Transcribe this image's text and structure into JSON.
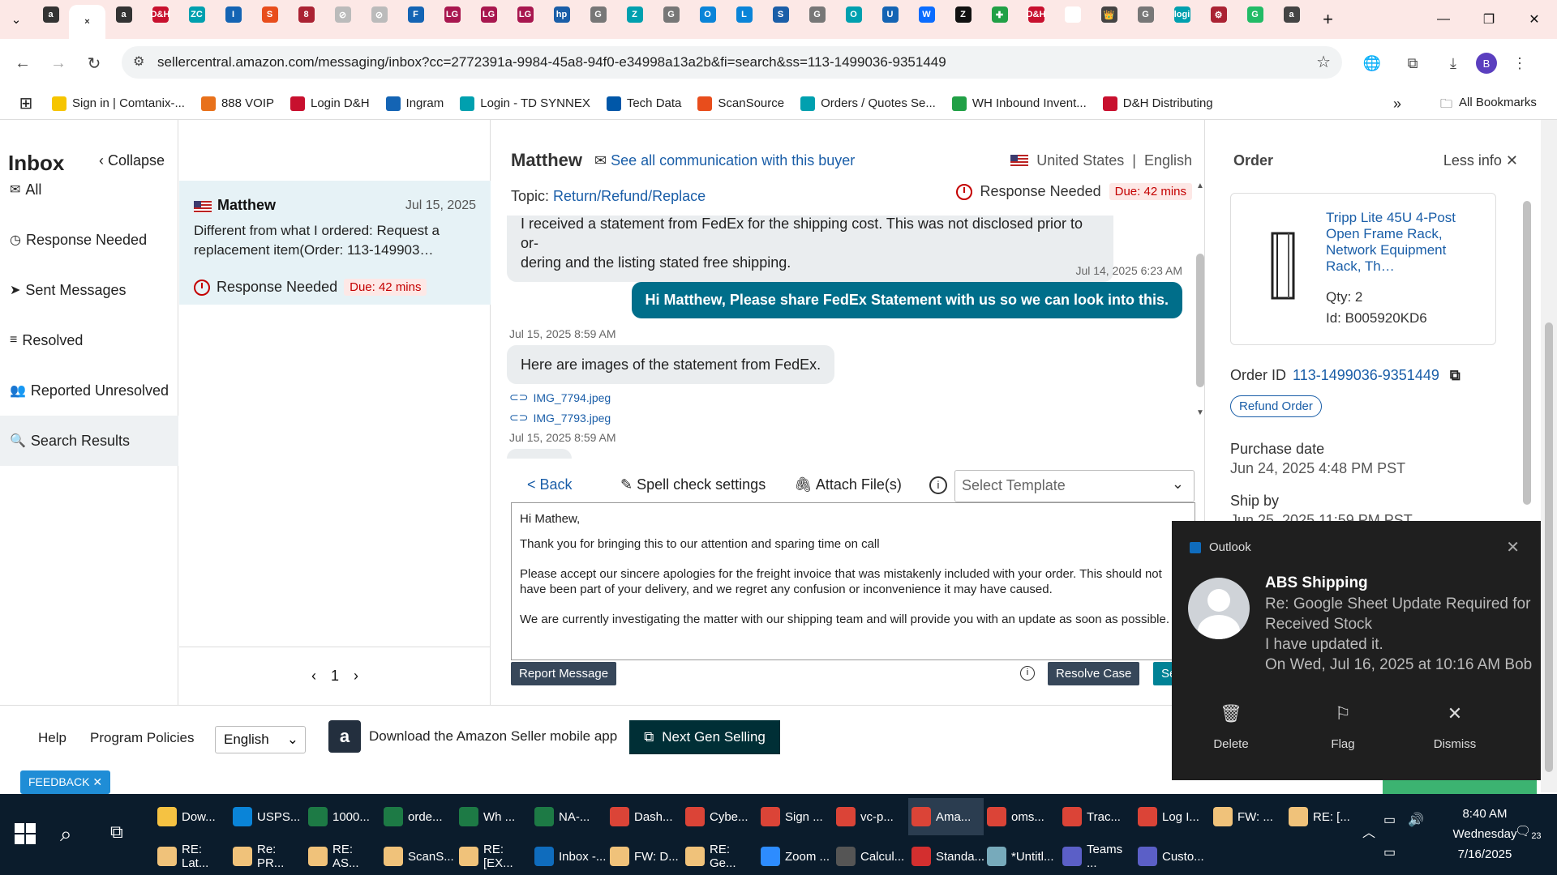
{
  "browser": {
    "tabs": [
      "a",
      "×",
      "a",
      "D&H",
      "ZC",
      "I",
      "S",
      "8",
      "⊘",
      "⊘",
      "F",
      "LG",
      "LG",
      "LG",
      "hp",
      "G",
      "Z",
      "G",
      "O",
      "L",
      "S",
      "G",
      "O",
      "U",
      "W",
      "Z",
      "✚",
      "D&H",
      "✉",
      "👑",
      "G",
      "logi",
      "⚙",
      "G",
      "a"
    ],
    "new_tab": "+",
    "url": "sellercentral.amazon.com/messaging/inbox?cc=2772391a-9984-45a8-94f0-e34998a13a2b&fi=search&ss=113-1499036-9351449",
    "profile": "B",
    "bookmarks": [
      {
        "label": "Sign in | Comtanix-...",
        "color": "#f6c500"
      },
      {
        "label": "888 VOIP",
        "color": "#e8711b"
      },
      {
        "label": "Login D&H",
        "color": "#c8102e"
      },
      {
        "label": "Ingram",
        "color": "#1464b4"
      },
      {
        "label": "Login - TD SYNNEX",
        "color": "#00a0af"
      },
      {
        "label": "Tech Data",
        "color": "#0057a8"
      },
      {
        "label": "ScanSource",
        "color": "#e84d1c"
      },
      {
        "label": "Orders / Quotes Se...",
        "color": "#00a0af"
      },
      {
        "label": "WH Inbound Invent...",
        "color": "#21a046"
      },
      {
        "label": "D&H Distributing",
        "color": "#c8102e"
      }
    ],
    "more_bookmarks": "»",
    "all_bookmarks": "All Bookmarks"
  },
  "sidebar": {
    "title": "Inbox",
    "collapse": "Collapse",
    "items": [
      {
        "label": "All",
        "icon": "✉"
      },
      {
        "label": "Response Needed",
        "icon": "◷"
      },
      {
        "label": "Sent Messages",
        "icon": "➤"
      },
      {
        "label": "Resolved",
        "icon": "≡"
      },
      {
        "label": "Reported Unresolved",
        "icon": "👥"
      },
      {
        "label": "Search Results",
        "icon": "🔍"
      }
    ]
  },
  "conversation": {
    "name": "Matthew",
    "date": "Jul 15, 2025",
    "preview": "Different from what I ordered: Request a replacement item(Order: 113-149903…",
    "status": "Response Needed",
    "due": "Due: 42 mins",
    "page": "1"
  },
  "chat": {
    "buyer": "Matthew",
    "see_all": "See all communication with this buyer",
    "country": "United States",
    "language": "English",
    "topic_label": "Topic:",
    "topic": "Return/Refund/Replace",
    "status": "Response Needed",
    "due": "Due: 42 mins",
    "msg1": "I received a statement from FedEx for the shipping cost. This was not disclosed prior to or-dering and the listing stated free shipping.",
    "msg1_line1": "I received a statement from FedEx for the shipping cost. This was not disclosed prior to or-",
    "msg1_line2": "dering and the listing stated free shipping.",
    "ts_out": "Jul 14, 2025 6:23 AM",
    "msg_out": "Hi Matthew, Please share FedEx Statement with us so we can look into this.",
    "ts_in": "Jul 15, 2025 8:59 AM",
    "msg2": "Here are images of the statement from FedEx.",
    "attachments": [
      "IMG_7794.jpeg",
      "IMG_7793.jpeg"
    ],
    "ts_in2": "Jul 15, 2025 8:59 AM",
    "back": "< Back",
    "spell": "Spell check settings",
    "attach": "Attach File(s)",
    "template_placeholder": "Select Template",
    "reply_lines": [
      "Hi Mathew,",
      "Thank you for bringing this to our attention and sparing time on call",
      "Please accept our sincere apologies for the freight invoice that was mistakenly included with your order. This should not have been part of your delivery, and we regret any confusion or inconvenience it may have caused.",
      "We are currently investigating the matter with our shipping team and will provide you with an update as soon as possible."
    ],
    "report": "Report Message",
    "resolve": "Resolve Case",
    "send": "Se"
  },
  "order": {
    "title": "Order",
    "less_info": "Less info",
    "product": "Tripp Lite 45U 4-Post Open Frame Rack, Network Equipment Rack, Th…",
    "qty": "Qty: 2",
    "id": "Id: B005920KD6",
    "order_id_label": "Order ID",
    "order_id": "113-1499036-9351449",
    "refund": "Refund Order",
    "purchase_label": "Purchase date",
    "purchase": "Jun 24, 2025 4:48 PM PST",
    "ship_label": "Ship by",
    "ship": "Jun 25, 2025 11:59 PM PST"
  },
  "footer": {
    "help": "Help",
    "policies": "Program Policies",
    "language": "English",
    "app": "Download the Amazon Seller mobile app",
    "ngs": "Next Gen Selling",
    "feedback": "FEEDBACK"
  },
  "toast": {
    "app": "Outlook",
    "sender": "ABS Shipping",
    "lines": [
      "Re: Google Sheet Update Required for",
      "Received Stock",
      "I have updated it.",
      "On Wed, Jul 16, 2025 at 10:16 AM Bob"
    ],
    "delete": "Delete",
    "flag": "Flag",
    "dismiss": "Dismiss"
  },
  "taskbar": {
    "row1": [
      {
        "label": "Dow...",
        "color": "#f5c242"
      },
      {
        "label": "USPS...",
        "color": "#0a84d8"
      },
      {
        "label": "1000...",
        "color": "#1d7a45"
      },
      {
        "label": "orde...",
        "color": "#1d7a45"
      },
      {
        "label": "Wh ...",
        "color": "#1d7a45"
      },
      {
        "label": "NA-...",
        "color": "#1d7a45"
      },
      {
        "label": "Dash...",
        "color": "#db4437"
      },
      {
        "label": "Cybe...",
        "color": "#db4437"
      },
      {
        "label": "Sign ...",
        "color": "#db4437"
      },
      {
        "label": "vc-p...",
        "color": "#db4437"
      },
      {
        "label": "Ama...",
        "color": "#db4437"
      },
      {
        "label": "oms...",
        "color": "#db4437"
      },
      {
        "label": "Trac...",
        "color": "#db4437"
      },
      {
        "label": "Log I...",
        "color": "#db4437"
      },
      {
        "label": "FW: ...",
        "color": "#f0c27a"
      },
      {
        "label": "RE: [...",
        "color": "#f0c27a"
      }
    ],
    "row2": [
      {
        "label": "RE: Lat...",
        "color": "#f0c27a"
      },
      {
        "label": "Re: PR...",
        "color": "#f0c27a"
      },
      {
        "label": "RE: AS...",
        "color": "#f0c27a"
      },
      {
        "label": "ScanS...",
        "color": "#f0c27a"
      },
      {
        "label": "RE: [EX...",
        "color": "#f0c27a"
      },
      {
        "label": "Inbox -...",
        "color": "#0f6cbd"
      },
      {
        "label": "FW: D...",
        "color": "#f0c27a"
      },
      {
        "label": "RE: Ge...",
        "color": "#f0c27a"
      },
      {
        "label": "Zoom ...",
        "color": "#2d8cff"
      },
      {
        "label": "Calcul...",
        "color": "#555"
      },
      {
        "label": "Standa...",
        "color": "#d32f2f"
      },
      {
        "label": "*Untitl...",
        "color": "#7ab"
      },
      {
        "label": "Teams ...",
        "color": "#5b5fc7"
      },
      {
        "label": "Custo...",
        "color": "#5b5fc7"
      }
    ],
    "time": "8:40 AM",
    "day": "Wednesday",
    "date": "7/16/2025",
    "notif": "23"
  }
}
